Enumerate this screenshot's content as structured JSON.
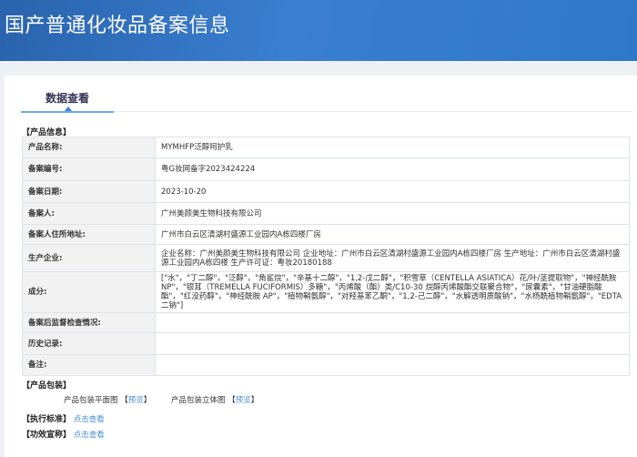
{
  "header": {
    "title": "国产普通化妆品备案信息"
  },
  "tab": {
    "label": "数据查看"
  },
  "product_info": {
    "section_title": "【产品信息】",
    "rows": [
      {
        "label": "产品名称:",
        "value": "MYMHFP泛醇呵护乳"
      },
      {
        "label": "备案编号:",
        "value": "粤G妆网备字2023424224"
      },
      {
        "label": "备案日期:",
        "value": "2023-10-20"
      },
      {
        "label": "备案人:",
        "value": "广州美颜美生物科技有限公司"
      },
      {
        "label": "备案人住所地址:",
        "value": "广州市白云区清湖村盛源工业园内A栋四楼厂房"
      },
      {
        "label": "生产企业:",
        "value": "企业名称：广州美颜美生物科技有限公司 企业地址：广州市白云区清湖村盛源工业园内A栋四楼厂房 生产地址：广州市白云区清湖村盛源工业园内A栋四楼 生产许可证：粤妆20180188"
      },
      {
        "label": "成分:",
        "value": "[\"水\"，\"丁二醇\"，\"泛醇\"，\"角鲨烷\"，\"辛基十二醇\"，\"1,2-戊二醇\"，\"积雪草（CENTELLA ASIATICA）花/叶/茎提取物\"，\"神经酰胺NP\"，\"银耳（TREMELLA FUCIFORMIS）多糖\"，\"丙烯酸（酯）类/C10-30 烷醇丙烯酸酯交联聚合物\"，\"尿囊素\"，\"甘油硬脂酸酯\"，\"红没药醇\"，\"神经酰胺 AP\"，\"植物鞘氨醇\"，\"对羟基苯乙酮\"，\"1,2-己二醇\"，\"水解透明质酸钠\"，\"水杨酰植物鞘氨醇\"，\"EDTA 二钠\"]"
      },
      {
        "label": "备案后监督检查情况:",
        "value": ""
      },
      {
        "label": "历史记录:",
        "value": ""
      },
      {
        "label": "备注:",
        "value": ""
      }
    ]
  },
  "packaging": {
    "section_title": "【产品包装】",
    "flat_label": "产品包装平面图",
    "flat_link": "预览",
    "solid_label": "产品包装立体图",
    "solid_link": "预览",
    "bl": "【",
    "br": "】"
  },
  "standard": {
    "section_title": "【执行标准】",
    "link": "点击查看"
  },
  "claims": {
    "section_title": "【功效宣称】",
    "link": "点击查看"
  }
}
